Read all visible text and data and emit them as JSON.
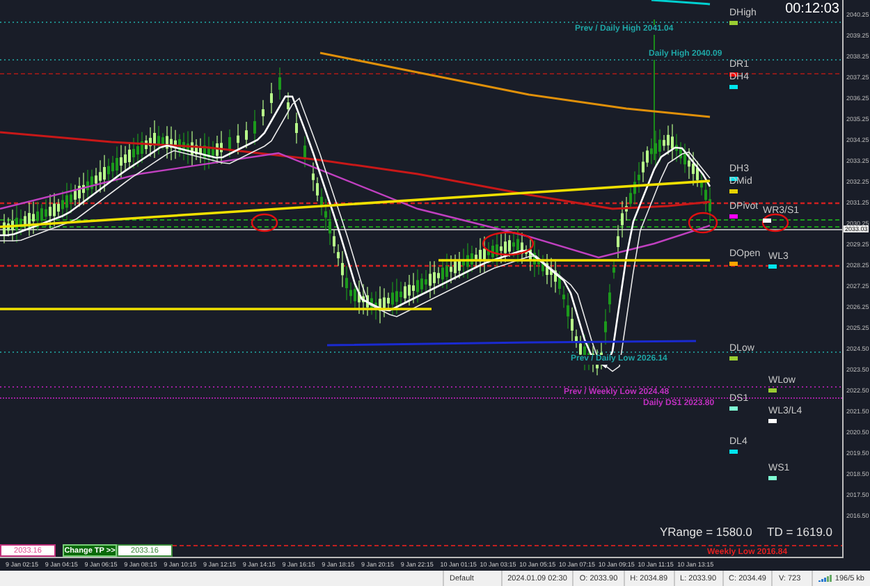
{
  "clock": "00:12:03",
  "level_labels": [
    {
      "text": "DHigh",
      "color": "#9acd32"
    },
    {
      "text": "DR1",
      "color": "#ff0000"
    },
    {
      "text": "DH4",
      "color": "#00e5ee"
    },
    {
      "text": "DH3",
      "color": "#00e5ee"
    },
    {
      "text": "DMid",
      "color": "#e6d200"
    },
    {
      "text": "DPivot",
      "color": "#ff00ff"
    },
    {
      "text": "WR3/S1",
      "color": "#ffffff"
    },
    {
      "text": "DOpen",
      "color": "#ffa500"
    },
    {
      "text": "WL3",
      "color": "#00e5ee"
    },
    {
      "text": "DLow",
      "color": "#9acd32"
    },
    {
      "text": "WLow",
      "color": "#9acd32"
    },
    {
      "text": "DS1",
      "color": "#7fffd4"
    },
    {
      "text": "WL3/L4",
      "color": "#ffffff"
    },
    {
      "text": "DL4",
      "color": "#00e5ee"
    },
    {
      "text": "WS1",
      "color": "#7fffd4"
    }
  ],
  "line_notes": [
    {
      "text": "Prev / Daily High 2041.04",
      "color": "#1fa5a5"
    },
    {
      "text": "Daily High 2040.09",
      "color": "#1fa5a5"
    },
    {
      "text": "Prev / Daily Low 2026.14",
      "color": "#1fa5a5"
    },
    {
      "text": "Prev / Weekly Low 2024.48",
      "color": "#c030c0"
    },
    {
      "text": "Daily DS1 2023.80",
      "color": "#c030c0"
    },
    {
      "text": "Weekly Low 2016.84",
      "color": "#e02020"
    }
  ],
  "stats": [
    "YRange = 1580.0",
    "TD = 1619.0"
  ],
  "trade_panel": {
    "price": "2033.16",
    "button": "Change TP >>",
    "target": "2033.16"
  },
  "price_axis": {
    "labels": [
      "2040.25",
      "2039.25",
      "2038.25",
      "2037.25",
      "2036.25",
      "2035.25",
      "2034.25",
      "2033.25",
      "2032.25",
      "2031.25",
      "2030.25",
      "2029.25",
      "2028.25",
      "2027.25",
      "2026.25",
      "2025.25",
      "2024.50",
      "2023.50",
      "2022.50",
      "2021.50",
      "2020.50",
      "2019.50",
      "2018.50",
      "2017.50",
      "2016.50"
    ],
    "current": "2033.03"
  },
  "time_axis": [
    "9 Jan 02:15",
    "9 Jan 04:15",
    "9 Jan 06:15",
    "9 Jan 08:15",
    "9 Jan 10:15",
    "9 Jan 12:15",
    "9 Jan 14:15",
    "9 Jan 16:15",
    "9 Jan 18:15",
    "9 Jan 20:15",
    "9 Jan 22:15",
    "10 Jan 01:15",
    "10 Jan 03:15",
    "10 Jan 05:15",
    "10 Jan 07:15",
    "10 Jan 09:15",
    "10 Jan 11:15",
    "10 Jan 13:15"
  ],
  "status_bar": [
    "Default",
    "2024.01.09 02:30",
    "O: 2033.90",
    "H: 2034.89",
    "L: 2033.90",
    "C: 2034.49",
    "V: 723",
    "196/5 kb"
  ]
}
